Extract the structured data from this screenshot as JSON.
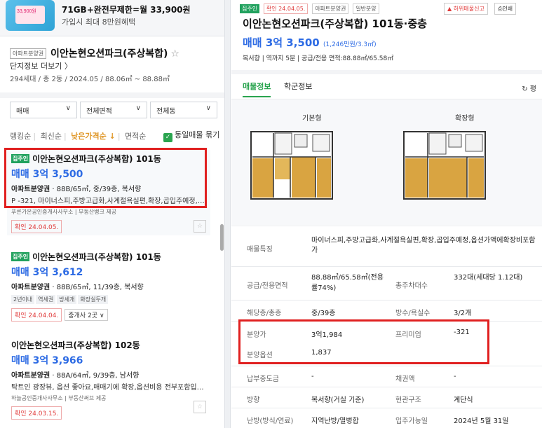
{
  "ad": {
    "thumb_text": "33,900원",
    "line1": "71GB+완전무제한=월 33,900원",
    "line2": "가입시 최대 8만원혜택"
  },
  "complex": {
    "tag": "아파트분양권",
    "name": "이안논현오션파크(주상복합)",
    "info_link": "단지정보 더보기 〉",
    "summary": "294세대 / 총 2동 / 2024.05 / 88.06㎡ ~ 88.88㎡"
  },
  "filters": {
    "trade": "매매",
    "area": "전체면적",
    "dong": "전체동"
  },
  "sort": {
    "items": [
      "랭킹순",
      "최신순",
      "낮은가격순 ↓",
      "면적순"
    ],
    "active_index": 2,
    "same_listing_label": "동일매물 묶기"
  },
  "listings": [
    {
      "badge": "집주인",
      "title": "이안논현오션파크(주상복합) 101동",
      "price": "매매 3억 3,500",
      "desc_bold": "아파트분양권",
      "desc": " · 88B/65㎡, 중/39층, 복서향",
      "desc2": "P -321, 마이너스피,주방고급화,사계절욕실편,확장,곱입주예정,옵션가액에확장비포함가",
      "agent": "푸른가온공인중개사사무소 | 부동산뱅크 제공",
      "confirm": "확인 24.04.05."
    },
    {
      "badge": "집주인",
      "title": "이안논현오션파크(주상복합) 101동",
      "price": "매매 3억 3,612",
      "desc_bold": "아파트분양권",
      "desc": " · 88B/65㎡, 11/39층, 복서향",
      "chips": [
        "2년이내",
        "역세권",
        "방세개",
        "화장실두개"
      ],
      "confirm": "확인 24.04.04.",
      "brokers": "중개사 2곳 ∨"
    },
    {
      "title": "이안논현오션파크(주상복합) 102동",
      "price": "매매 3억 3,966",
      "desc_bold": "아파트분양권",
      "desc": " · 88A/64㎡, 9/39층, 남서향",
      "desc2": "탁트인 광장뷰, 옵션 좋아요,매매기에 확장,옵션비용 전부포함입니다",
      "agent": "하늘공인중개사사무소 | 부동산써브 제공",
      "confirm": "확인 24.03.15."
    }
  ],
  "detail": {
    "tags": [
      "집주인",
      "확인 24.04.05.",
      "아파트분양권",
      "일반분양"
    ],
    "report_button": "허위매물신고",
    "print_button": "인쇄",
    "title": "이안논현오션파크(주상복합) 101동·중층",
    "price": "매매 3억 3,500",
    "price_per": "(1,246만원/3.3㎡)",
    "sub": "복서향 | 역까지 5분 | 공급/전용 면적:88.88㎡/65.58㎡",
    "tabs": [
      "매물정보",
      "학군정보"
    ],
    "refresh": "↻ 평",
    "plans": [
      "기본형",
      "확장형"
    ],
    "rows": [
      {
        "l1": "매물특징",
        "v1": "마이너스피,주방고급화,사계절욕실편,확장,곱입주예정,옵션가액에확장비포함가"
      },
      {
        "l1": "공급/전용면적",
        "v1": "88.88㎡/65.58㎡(전용률74%)",
        "l2": "총주차대수",
        "v2": "332대(세대당 1.12대)"
      },
      {
        "l1": "해당층/총층",
        "v1": "중/39층",
        "l2": "방수/욕실수",
        "v2": "3/2개"
      },
      {
        "l1": "분양가",
        "v1": "3억1,984",
        "l2": "프리미엄",
        "v2": "-321"
      },
      {
        "l1": "분양옵션",
        "v1": "1,837"
      },
      {
        "l1": "납부중도금",
        "v1": "-",
        "l2": "채권액",
        "v2": "-"
      },
      {
        "l1": "방향",
        "v1": "복서향(거실 기준)",
        "l2": "현관구조",
        "v2": "계단식"
      },
      {
        "l1": "난방(방식/연료)",
        "v1": "지역난방/열병합",
        "l2": "입주가능일",
        "v2": "2024년 5월 31일"
      }
    ]
  },
  "colors": {
    "accent_green": "#2aa44f",
    "price_blue": "#2d6be4",
    "highlight_red": "#e02020",
    "sort_orange": "#e0982a"
  }
}
